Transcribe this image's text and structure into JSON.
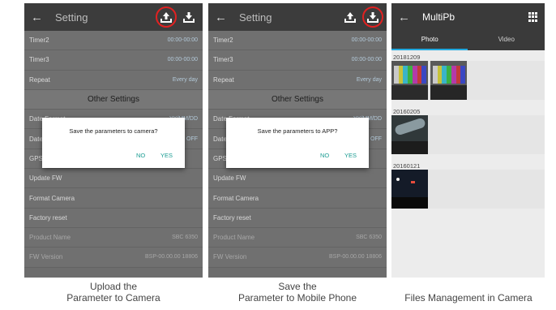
{
  "panels": [
    {
      "title": "Setting",
      "rows": [
        {
          "label": "Timer2",
          "value": "00:00-00:00"
        },
        {
          "label": "Timer3",
          "value": "00:00-00:00"
        },
        {
          "label": "Repeat",
          "value": "Every day"
        },
        {
          "label": "Other Settings",
          "value": ""
        },
        {
          "label": "Date Format",
          "value": "YY/MM/DD"
        },
        {
          "label": "Date Stamp",
          "value": "OFF"
        },
        {
          "label": "GPS",
          "value": ""
        },
        {
          "label": "Update FW",
          "value": ""
        },
        {
          "label": "Format Camera",
          "value": ""
        },
        {
          "label": "Factory reset",
          "value": ""
        },
        {
          "label": "Product Name",
          "value": "SBC 6350"
        },
        {
          "label": "FW Version",
          "value": "BSP-00.00.00 18806"
        }
      ],
      "dialog": {
        "message": "Save the parameters to camera?",
        "no": "NO",
        "yes": "YES"
      },
      "caption_line1": "Upload the",
      "caption_line2": "Parameter to Camera"
    },
    {
      "title": "Setting",
      "rows": [
        {
          "label": "Timer2",
          "value": "00:00-00:00"
        },
        {
          "label": "Timer3",
          "value": "00:00-00:00"
        },
        {
          "label": "Repeat",
          "value": "Every day"
        },
        {
          "label": "Other Settings",
          "value": ""
        },
        {
          "label": "Date Format",
          "value": "YY/MM/DD"
        },
        {
          "label": "Date Stamp",
          "value": "OFF"
        },
        {
          "label": "GPS",
          "value": ""
        },
        {
          "label": "Update FW",
          "value": ""
        },
        {
          "label": "Format Camera",
          "value": ""
        },
        {
          "label": "Factory reset",
          "value": ""
        },
        {
          "label": "Product Name",
          "value": "SBC 6350"
        },
        {
          "label": "FW Version",
          "value": "BSP-00.00.00 18806"
        }
      ],
      "dialog": {
        "message": "Save the parameters to APP?",
        "no": "NO",
        "yes": "YES"
      },
      "caption_line1": "Save the",
      "caption_line2": "Parameter to Mobile Phone"
    }
  ],
  "gallery": {
    "title": "MultiPb",
    "tabs": [
      "Photo",
      "Video"
    ],
    "groups": [
      {
        "date": "20181209"
      },
      {
        "date": "20160205"
      },
      {
        "date": "20160121"
      }
    ],
    "caption": "Files Management in Camera"
  },
  "colors": {
    "accent": "#21a9df",
    "dialog_button": "#1a9c92",
    "highlight_ring": "#e12121"
  },
  "icons": {
    "back": "arrow-left-icon",
    "upload": "upload-icon",
    "download": "download-icon",
    "grid": "grid-icon"
  }
}
